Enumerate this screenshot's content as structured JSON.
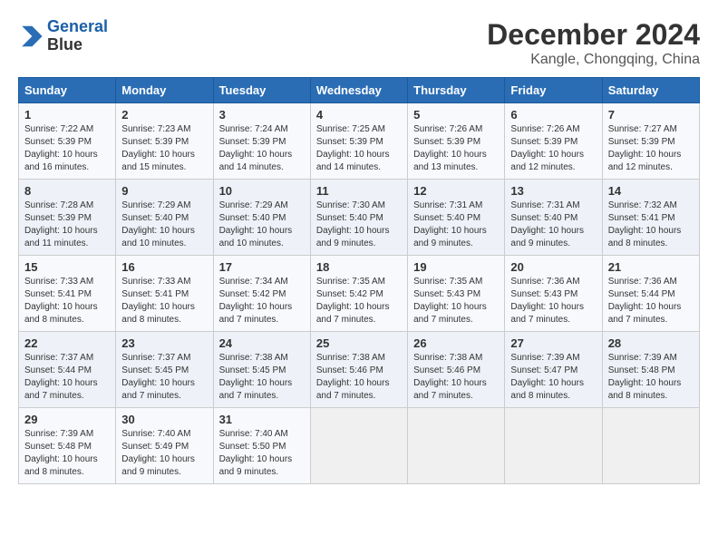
{
  "logo": {
    "line1": "General",
    "line2": "Blue"
  },
  "title": "December 2024",
  "location": "Kangle, Chongqing, China",
  "days_of_week": [
    "Sunday",
    "Monday",
    "Tuesday",
    "Wednesday",
    "Thursday",
    "Friday",
    "Saturday"
  ],
  "weeks": [
    [
      {
        "day": "1",
        "info": "Sunrise: 7:22 AM\nSunset: 5:39 PM\nDaylight: 10 hours\nand 16 minutes."
      },
      {
        "day": "2",
        "info": "Sunrise: 7:23 AM\nSunset: 5:39 PM\nDaylight: 10 hours\nand 15 minutes."
      },
      {
        "day": "3",
        "info": "Sunrise: 7:24 AM\nSunset: 5:39 PM\nDaylight: 10 hours\nand 14 minutes."
      },
      {
        "day": "4",
        "info": "Sunrise: 7:25 AM\nSunset: 5:39 PM\nDaylight: 10 hours\nand 14 minutes."
      },
      {
        "day": "5",
        "info": "Sunrise: 7:26 AM\nSunset: 5:39 PM\nDaylight: 10 hours\nand 13 minutes."
      },
      {
        "day": "6",
        "info": "Sunrise: 7:26 AM\nSunset: 5:39 PM\nDaylight: 10 hours\nand 12 minutes."
      },
      {
        "day": "7",
        "info": "Sunrise: 7:27 AM\nSunset: 5:39 PM\nDaylight: 10 hours\nand 12 minutes."
      }
    ],
    [
      {
        "day": "8",
        "info": "Sunrise: 7:28 AM\nSunset: 5:39 PM\nDaylight: 10 hours\nand 11 minutes."
      },
      {
        "day": "9",
        "info": "Sunrise: 7:29 AM\nSunset: 5:40 PM\nDaylight: 10 hours\nand 10 minutes."
      },
      {
        "day": "10",
        "info": "Sunrise: 7:29 AM\nSunset: 5:40 PM\nDaylight: 10 hours\nand 10 minutes."
      },
      {
        "day": "11",
        "info": "Sunrise: 7:30 AM\nSunset: 5:40 PM\nDaylight: 10 hours\nand 9 minutes."
      },
      {
        "day": "12",
        "info": "Sunrise: 7:31 AM\nSunset: 5:40 PM\nDaylight: 10 hours\nand 9 minutes."
      },
      {
        "day": "13",
        "info": "Sunrise: 7:31 AM\nSunset: 5:40 PM\nDaylight: 10 hours\nand 9 minutes."
      },
      {
        "day": "14",
        "info": "Sunrise: 7:32 AM\nSunset: 5:41 PM\nDaylight: 10 hours\nand 8 minutes."
      }
    ],
    [
      {
        "day": "15",
        "info": "Sunrise: 7:33 AM\nSunset: 5:41 PM\nDaylight: 10 hours\nand 8 minutes."
      },
      {
        "day": "16",
        "info": "Sunrise: 7:33 AM\nSunset: 5:41 PM\nDaylight: 10 hours\nand 8 minutes."
      },
      {
        "day": "17",
        "info": "Sunrise: 7:34 AM\nSunset: 5:42 PM\nDaylight: 10 hours\nand 7 minutes."
      },
      {
        "day": "18",
        "info": "Sunrise: 7:35 AM\nSunset: 5:42 PM\nDaylight: 10 hours\nand 7 minutes."
      },
      {
        "day": "19",
        "info": "Sunrise: 7:35 AM\nSunset: 5:43 PM\nDaylight: 10 hours\nand 7 minutes."
      },
      {
        "day": "20",
        "info": "Sunrise: 7:36 AM\nSunset: 5:43 PM\nDaylight: 10 hours\nand 7 minutes."
      },
      {
        "day": "21",
        "info": "Sunrise: 7:36 AM\nSunset: 5:44 PM\nDaylight: 10 hours\nand 7 minutes."
      }
    ],
    [
      {
        "day": "22",
        "info": "Sunrise: 7:37 AM\nSunset: 5:44 PM\nDaylight: 10 hours\nand 7 minutes."
      },
      {
        "day": "23",
        "info": "Sunrise: 7:37 AM\nSunset: 5:45 PM\nDaylight: 10 hours\nand 7 minutes."
      },
      {
        "day": "24",
        "info": "Sunrise: 7:38 AM\nSunset: 5:45 PM\nDaylight: 10 hours\nand 7 minutes."
      },
      {
        "day": "25",
        "info": "Sunrise: 7:38 AM\nSunset: 5:46 PM\nDaylight: 10 hours\nand 7 minutes."
      },
      {
        "day": "26",
        "info": "Sunrise: 7:38 AM\nSunset: 5:46 PM\nDaylight: 10 hours\nand 7 minutes."
      },
      {
        "day": "27",
        "info": "Sunrise: 7:39 AM\nSunset: 5:47 PM\nDaylight: 10 hours\nand 8 minutes."
      },
      {
        "day": "28",
        "info": "Sunrise: 7:39 AM\nSunset: 5:48 PM\nDaylight: 10 hours\nand 8 minutes."
      }
    ],
    [
      {
        "day": "29",
        "info": "Sunrise: 7:39 AM\nSunset: 5:48 PM\nDaylight: 10 hours\nand 8 minutes."
      },
      {
        "day": "30",
        "info": "Sunrise: 7:40 AM\nSunset: 5:49 PM\nDaylight: 10 hours\nand 9 minutes."
      },
      {
        "day": "31",
        "info": "Sunrise: 7:40 AM\nSunset: 5:50 PM\nDaylight: 10 hours\nand 9 minutes."
      },
      {
        "day": "",
        "info": ""
      },
      {
        "day": "",
        "info": ""
      },
      {
        "day": "",
        "info": ""
      },
      {
        "day": "",
        "info": ""
      }
    ]
  ]
}
